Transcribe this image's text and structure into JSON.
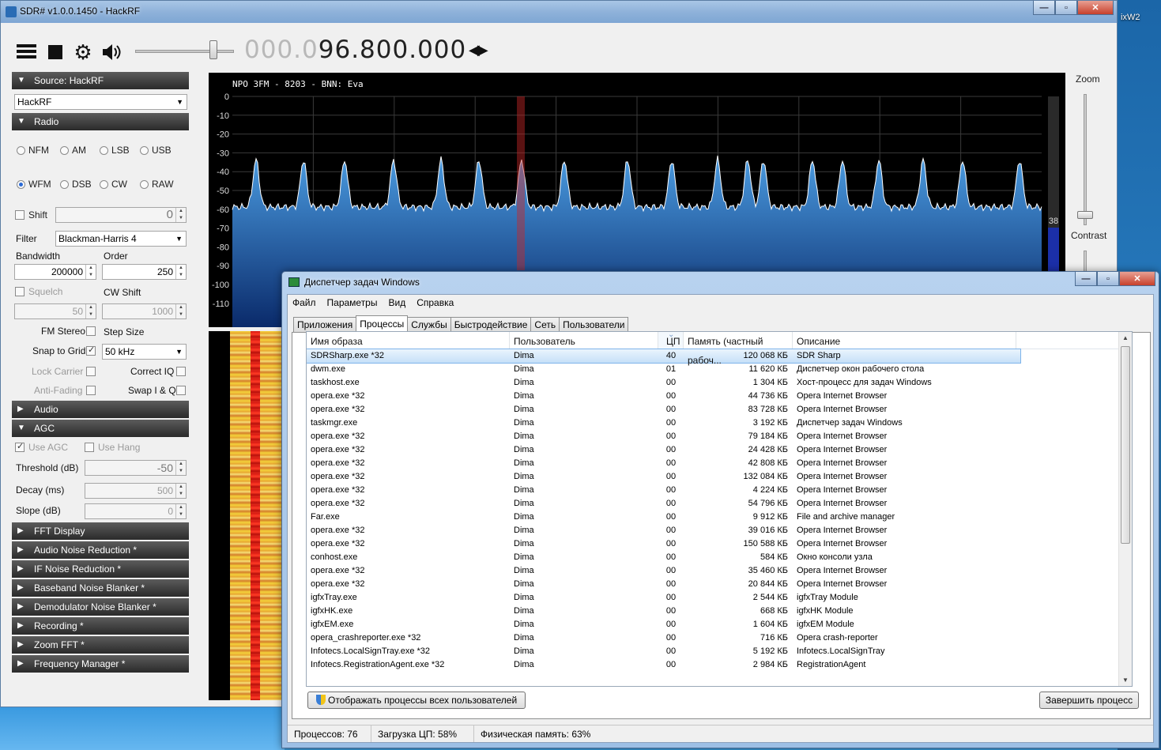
{
  "desktop": {
    "right_label": "ixW2"
  },
  "sdr": {
    "title": "SDR# v1.0.0.1450 - HackRF",
    "frequency_dim": "000.0",
    "frequency_bright": "96.800.000",
    "spectrum_title": "NPO 3FM  - 8203 - BNN: Eva",
    "level_readout": "38",
    "zoom_label": "Zoom",
    "contrast_label": "Contrast",
    "spectrum_y_ticks": [
      "0",
      "-10",
      "-20",
      "-30",
      "-40",
      "-50",
      "-60",
      "-70",
      "-80",
      "-90",
      "-100",
      "-110"
    ],
    "sections": {
      "source": "Source: HackRF",
      "source_device": "HackRF",
      "radio": "Radio",
      "audio": "Audio",
      "agc": "AGC",
      "collapsed": [
        "FFT Display",
        "Audio Noise Reduction *",
        "IF Noise Reduction *",
        "Baseband Noise Blanker *",
        "Demodulator Noise Blanker *",
        "Recording *",
        "Zoom FFT *",
        "Frequency Manager *"
      ]
    },
    "radio": {
      "modes_row1": [
        "NFM",
        "AM",
        "LSB",
        "USB"
      ],
      "modes_row2": [
        "WFM",
        "DSB",
        "CW",
        "RAW"
      ],
      "selected_mode": "WFM",
      "shift_label": "Shift",
      "shift_value": "0",
      "filter_label": "Filter",
      "filter_value": "Blackman-Harris 4",
      "bandwidth_label": "Bandwidth",
      "bandwidth_value": "200000",
      "order_label": "Order",
      "order_value": "250",
      "squelch_label": "Squelch",
      "squelch_value": "50",
      "cwshift_label": "CW Shift",
      "cwshift_value": "1000",
      "fmstereo_label": "FM Stereo",
      "stepsize_label": "Step Size",
      "snap_label": "Snap to Grid",
      "step_value": "50 kHz",
      "lockcarrier_label": "Lock Carrier",
      "correctiq_label": "Correct IQ",
      "antifading_label": "Anti-Fading",
      "swapiq_label": "Swap I & Q"
    },
    "agc": {
      "use_agc": "Use AGC",
      "use_hang": "Use Hang",
      "threshold_label": "Threshold (dB)",
      "threshold_value": "-50",
      "decay_label": "Decay (ms)",
      "decay_value": "500",
      "slope_label": "Slope (dB)",
      "slope_value": "0"
    }
  },
  "taskmgr": {
    "title": "Диспетчер задач Windows",
    "menu": [
      "Файл",
      "Параметры",
      "Вид",
      "Справка"
    ],
    "tabs": [
      "Приложения",
      "Процессы",
      "Службы",
      "Быстродействие",
      "Сеть",
      "Пользователи"
    ],
    "active_tab": "Процессы",
    "columns": [
      "Имя образа",
      "Пользователь",
      "ЦП",
      "Память (частный рабоч...",
      "Описание"
    ],
    "rows": [
      [
        "SDRSharp.exe *32",
        "Dima",
        "40",
        "120 068 КБ",
        "SDR Sharp"
      ],
      [
        "dwm.exe",
        "Dima",
        "01",
        "11 620 КБ",
        "Диспетчер окон рабочего стола"
      ],
      [
        "taskhost.exe",
        "Dima",
        "00",
        "1 304 КБ",
        "Хост-процесс для задач Windows"
      ],
      [
        "opera.exe *32",
        "Dima",
        "00",
        "44 736 КБ",
        "Opera Internet Browser"
      ],
      [
        "opera.exe *32",
        "Dima",
        "00",
        "83 728 КБ",
        "Opera Internet Browser"
      ],
      [
        "taskmgr.exe",
        "Dima",
        "00",
        "3 192 КБ",
        "Диспетчер задач Windows"
      ],
      [
        "opera.exe *32",
        "Dima",
        "00",
        "79 184 КБ",
        "Opera Internet Browser"
      ],
      [
        "opera.exe *32",
        "Dima",
        "00",
        "24 428 КБ",
        "Opera Internet Browser"
      ],
      [
        "opera.exe *32",
        "Dima",
        "00",
        "42 808 КБ",
        "Opera Internet Browser"
      ],
      [
        "opera.exe *32",
        "Dima",
        "00",
        "132 084 КБ",
        "Opera Internet Browser"
      ],
      [
        "opera.exe *32",
        "Dima",
        "00",
        "4 224 КБ",
        "Opera Internet Browser"
      ],
      [
        "opera.exe *32",
        "Dima",
        "00",
        "54 796 КБ",
        "Opera Internet Browser"
      ],
      [
        "Far.exe",
        "Dima",
        "00",
        "9 912 КБ",
        "File and archive manager"
      ],
      [
        "opera.exe *32",
        "Dima",
        "00",
        "39 016 КБ",
        "Opera Internet Browser"
      ],
      [
        "opera.exe *32",
        "Dima",
        "00",
        "150 588 КБ",
        "Opera Internet Browser"
      ],
      [
        "conhost.exe",
        "Dima",
        "00",
        "584 КБ",
        "Окно консоли узла"
      ],
      [
        "opera.exe *32",
        "Dima",
        "00",
        "35 460 КБ",
        "Opera Internet Browser"
      ],
      [
        "opera.exe *32",
        "Dima",
        "00",
        "20 844 КБ",
        "Opera Internet Browser"
      ],
      [
        "igfxTray.exe",
        "Dima",
        "00",
        "2 544 КБ",
        "igfxTray Module"
      ],
      [
        "igfxHK.exe",
        "Dima",
        "00",
        "668 КБ",
        "igfxHK Module"
      ],
      [
        "igfxEM.exe",
        "Dima",
        "00",
        "1 604 КБ",
        "igfxEM Module"
      ],
      [
        "opera_crashreporter.exe *32",
        "Dima",
        "00",
        "716 КБ",
        "Opera crash-reporter"
      ],
      [
        "Infotecs.LocalSignTray.exe *32",
        "Dima",
        "00",
        "5 192 КБ",
        "Infotecs.LocalSignTray"
      ],
      [
        "Infotecs.RegistrationAgent.exe *32",
        "Dima",
        "00",
        "2 984 КБ",
        "RegistrationAgent"
      ]
    ],
    "show_all_button": "Отображать процессы всех пользователей",
    "end_process_button": "Завершить процесс",
    "status_processes": "Процессов: 76",
    "status_cpu": "Загрузка ЦП: 58%",
    "status_memory": "Физическая память: 63%"
  },
  "colors": {
    "spectrum_fill_top": "#4a9be0",
    "spectrum_fill_bottom": "#0a2a6a",
    "selection_blue": "#c6e0f8"
  }
}
